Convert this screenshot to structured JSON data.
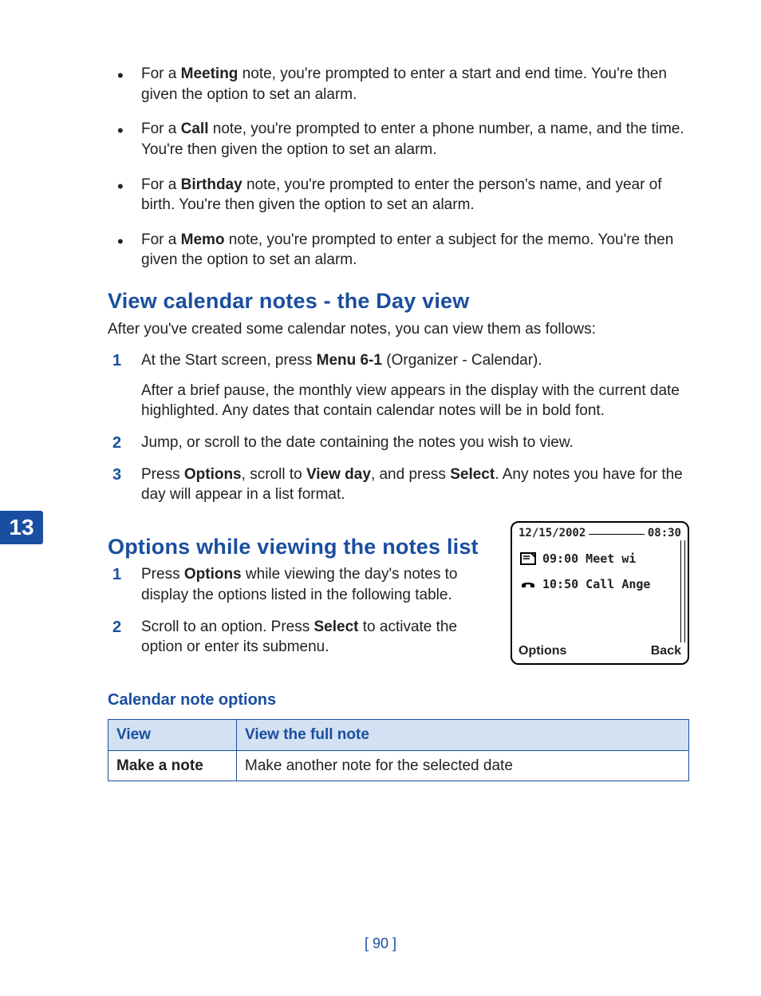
{
  "chapter": "13",
  "bullets": [
    {
      "prefix": "For a ",
      "bold": "Meeting",
      "suffix": " note, you're prompted to enter a start and end time. You're then given the option to set an alarm."
    },
    {
      "prefix": "For a ",
      "bold": "Call",
      "suffix": " note, you're prompted to enter a phone number, a name, and the time. You're then given the option to set an alarm."
    },
    {
      "prefix": "For a ",
      "bold": "Birthday",
      "suffix": " note, you're prompted to enter the person's name, and year of birth. You're then given the option to set an alarm."
    },
    {
      "prefix": "For a ",
      "bold": "Memo",
      "suffix": " note, you're prompted to enter a subject for the memo. You're then given the option to set an alarm."
    }
  ],
  "section1": {
    "title": "View calendar notes - the Day view",
    "intro": "After you've created some calendar notes, you can view them as follows:",
    "step1_a": "At the Start screen, press ",
    "step1_b": "Menu 6-1",
    "step1_c": " (Organizer - Calendar).",
    "step1_p2": "After a brief pause, the monthly view appears in the display with the current date highlighted. Any dates that contain calendar notes will be in bold font.",
    "step2": "Jump, or scroll to the date containing the notes you wish to view.",
    "step3_a": "Press ",
    "step3_b": "Options",
    "step3_c": ", scroll to ",
    "step3_d": "View day",
    "step3_e": ", and press ",
    "step3_f": "Select",
    "step3_g": ". Any notes you have for the day will appear in a list format."
  },
  "section2": {
    "title": "Options while viewing the notes list",
    "step1_a": "Press ",
    "step1_b": "Options",
    "step1_c": " while viewing the day's notes to display the options listed in the following table.",
    "step2_a": "Scroll to an option. Press ",
    "step2_b": "Select",
    "step2_c": " to activate the option or enter its submenu."
  },
  "phone": {
    "date": "12/15/2002",
    "time": "08:30",
    "entry1": "09:00 Meet wi",
    "entry2": "10:50 Call Ange",
    "softLeft": "Options",
    "softRight": "Back"
  },
  "table": {
    "caption": "Calendar note options",
    "header": {
      "c1": "View",
      "c2": "View the full note"
    },
    "row1": {
      "c1": "Make a note",
      "c2": "Make another note for the selected date"
    }
  },
  "pageNum": "[ 90 ]"
}
